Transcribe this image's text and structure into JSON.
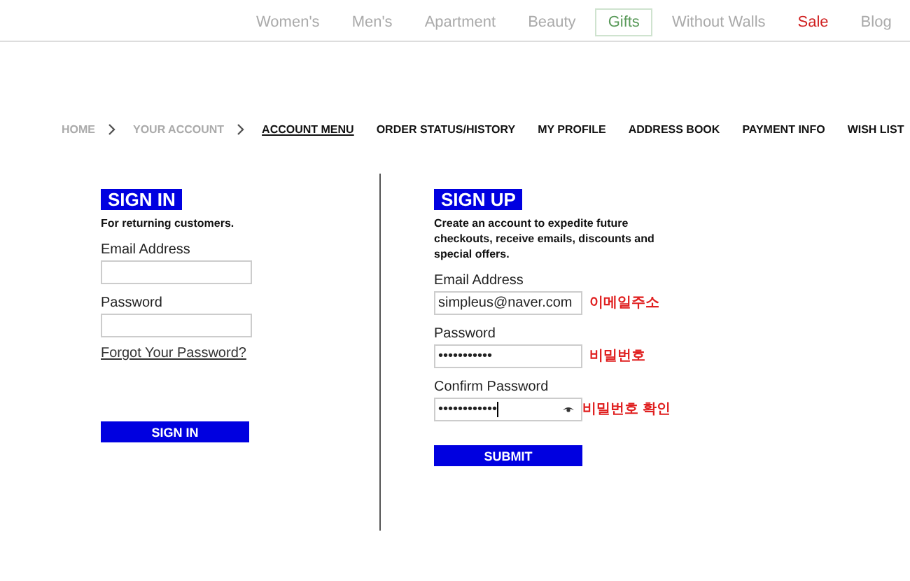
{
  "top_nav": [
    {
      "label": "Women's",
      "kind": "link",
      "selected": false
    },
    {
      "label": "Men's",
      "kind": "link",
      "selected": false
    },
    {
      "label": "Apartment",
      "kind": "link",
      "selected": false
    },
    {
      "label": "Beauty",
      "kind": "link",
      "selected": false
    },
    {
      "label": "Gifts",
      "kind": "link",
      "selected": true
    },
    {
      "label": "Without Walls",
      "kind": "link",
      "selected": false
    },
    {
      "label": "Sale",
      "kind": "sale",
      "selected": false
    },
    {
      "label": "Blog",
      "kind": "link",
      "selected": false
    }
  ],
  "breadcrumb": [
    "HOME",
    "YOUR ACCOUNT"
  ],
  "account_menu": [
    {
      "label": "ACCOUNT MENU",
      "selected": true
    },
    {
      "label": "ORDER STATUS/HISTORY",
      "selected": false
    },
    {
      "label": "MY PROFILE",
      "selected": false
    },
    {
      "label": "ADDRESS BOOK",
      "selected": false
    },
    {
      "label": "PAYMENT INFO",
      "selected": false
    },
    {
      "label": "WISH LIST",
      "selected": false
    }
  ],
  "sign_in": {
    "title": "SIGN IN",
    "subtitle": "For returning customers.",
    "fields": [
      {
        "label": "Email Address"
      },
      {
        "label": "Password"
      }
    ],
    "forgot_link": "Forgot Your Password?",
    "button": "SIGN IN"
  },
  "sign_up": {
    "title": "SIGN UP",
    "subtitle": "Create an account to expedite future checkouts, receive emails, discounts and special offers.",
    "fields": [
      {
        "label": "Email Address",
        "value": "simpleus@naver.com",
        "note": "이메일주소",
        "caret": false
      },
      {
        "label": "Password",
        "value": "•••••••••••",
        "note": "비밀번호",
        "caret": false
      },
      {
        "label": "Confirm Password",
        "value": "••••••••••••",
        "note": "비밀번호 확인",
        "caret": true
      }
    ],
    "button": "SUBMIT"
  }
}
